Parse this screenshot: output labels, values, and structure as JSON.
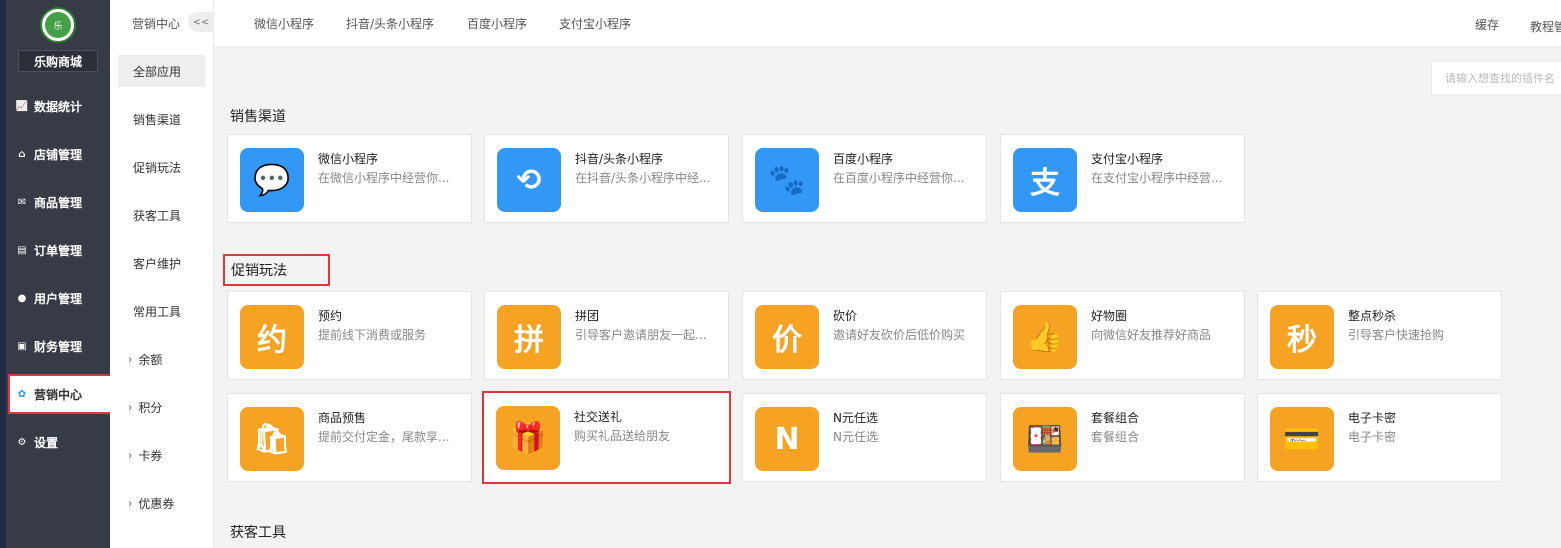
{
  "sidebar": {
    "logo_text": "乐",
    "shop_name": "乐购商城",
    "items": [
      {
        "label": "数据统计",
        "icon": "chart-icon",
        "glyph": "📈"
      },
      {
        "label": "店铺管理",
        "icon": "store-icon",
        "glyph": "⌂"
      },
      {
        "label": "商品管理",
        "icon": "mail-icon",
        "glyph": "✉"
      },
      {
        "label": "订单管理",
        "icon": "order-icon",
        "glyph": "▤"
      },
      {
        "label": "用户管理",
        "icon": "user-icon",
        "glyph": "●"
      },
      {
        "label": "财务管理",
        "icon": "finance-icon",
        "glyph": "▣"
      },
      {
        "label": "营销中心",
        "icon": "marketing-icon",
        "glyph": "✿"
      },
      {
        "label": "设置",
        "icon": "settings-icon",
        "glyph": "⚙"
      }
    ],
    "active_index": 6
  },
  "submenu": {
    "title": "营销中心",
    "collapse": "<<",
    "items": [
      {
        "label": "全部应用",
        "chev": ""
      },
      {
        "label": "销售渠道",
        "chev": ""
      },
      {
        "label": "促销玩法",
        "chev": ""
      },
      {
        "label": "获客工具",
        "chev": ""
      },
      {
        "label": "客户维护",
        "chev": ""
      },
      {
        "label": "常用工具",
        "chev": ""
      },
      {
        "label": "余额",
        "chev": "›"
      },
      {
        "label": "积分",
        "chev": "›"
      },
      {
        "label": "卡券",
        "chev": "›"
      },
      {
        "label": "优惠券",
        "chev": "›"
      }
    ]
  },
  "topbar": {
    "tabs": [
      "微信小程序",
      "抖音/头条小程序",
      "百度小程序",
      "支付宝小程序"
    ],
    "right": [
      "缓存",
      "教程管"
    ]
  },
  "search": {
    "placeholder": "请输入想查找的插件名"
  },
  "sections": {
    "sales": "销售渠道",
    "promo": "促销玩法",
    "acquire": "获客工具"
  },
  "sales_cards": [
    {
      "title": "微信小程序",
      "desc": "在微信小程序中经营你...",
      "icon": "wechat-icon",
      "glyph": "💬"
    },
    {
      "title": "抖音/头条小程序",
      "desc": "在抖音/头条小程序中经...",
      "icon": "douyin-icon",
      "glyph": "⟲"
    },
    {
      "title": "百度小程序",
      "desc": "在百度小程序中经营你...",
      "icon": "baidu-icon",
      "glyph": "🐾"
    },
    {
      "title": "支付宝小程序",
      "desc": "在支付宝小程序中经营...",
      "icon": "alipay-icon",
      "glyph": "支"
    }
  ],
  "promo_cards": [
    {
      "title": "预约",
      "desc": "提前线下消费或服务",
      "icon": "booking-icon",
      "glyph": "约"
    },
    {
      "title": "拼团",
      "desc": "引导客户邀请朋友一起...",
      "icon": "group-buy-icon",
      "glyph": "拼"
    },
    {
      "title": "砍价",
      "desc": "邀请好友砍价后低价购买",
      "icon": "bargain-icon",
      "glyph": "价"
    },
    {
      "title": "好物圈",
      "desc": "向微信好友推荐好商品",
      "icon": "thumbs-up-icon",
      "glyph": "👍"
    },
    {
      "title": "整点秒杀",
      "desc": "引导客户快速抢购",
      "icon": "flash-sale-icon",
      "glyph": "秒"
    },
    {
      "title": "商品预售",
      "desc": "提前交付定金，尾款享...",
      "icon": "presale-icon",
      "glyph": "🛍"
    },
    {
      "title": "社交送礼",
      "desc": "购买礼品送给朋友",
      "icon": "gift-icon",
      "glyph": "🎁"
    },
    {
      "title": "N元任选",
      "desc": "N元任选",
      "icon": "n-choice-icon",
      "glyph": "N"
    },
    {
      "title": "套餐组合",
      "desc": "套餐组合",
      "icon": "combo-icon",
      "glyph": "🍱"
    },
    {
      "title": "电子卡密",
      "desc": "电子卡密",
      "icon": "ecard-icon",
      "glyph": "💳"
    }
  ]
}
